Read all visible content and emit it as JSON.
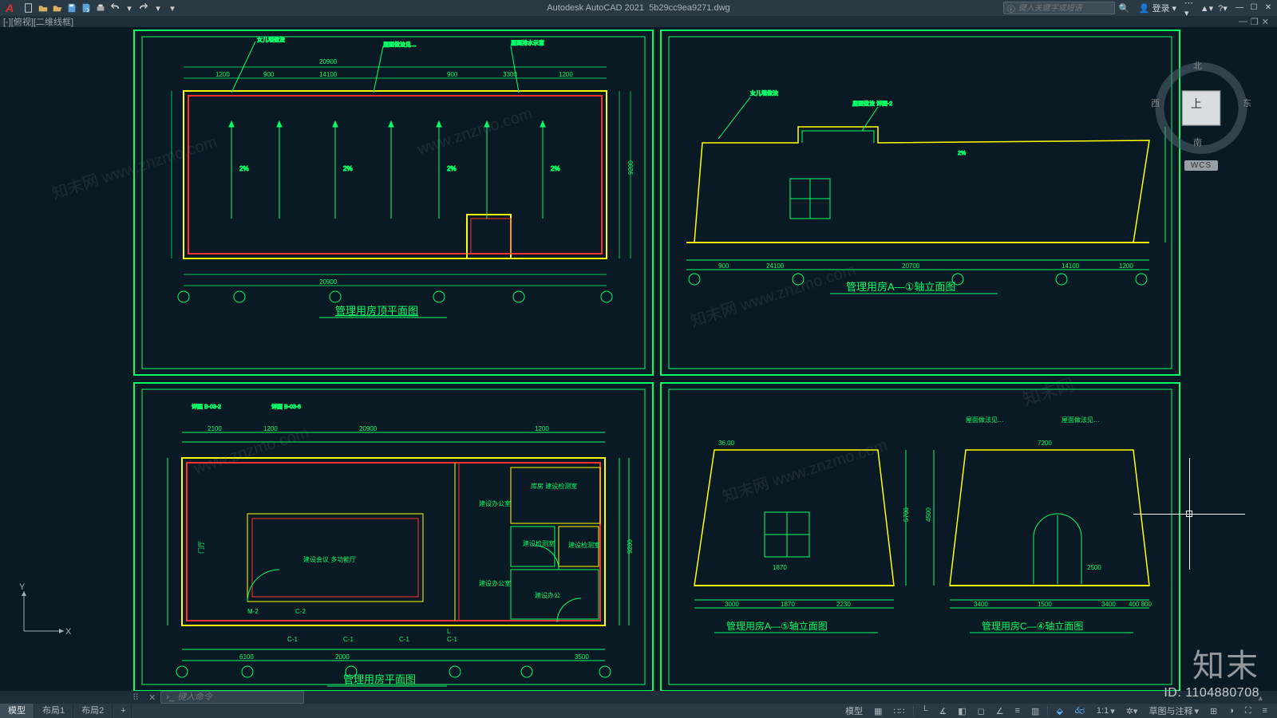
{
  "app": {
    "product": "Autodesk AutoCAD 2021",
    "filename": "5b29cc9ea9271.dwg"
  },
  "title": {
    "search_placeholder": "键入关键字或短语",
    "login": "登录"
  },
  "viewport": {
    "label": "[-][俯视][二维线框]"
  },
  "viewcube": {
    "n": "北",
    "s": "南",
    "e": "东",
    "w": "西",
    "top": "上",
    "wcs": "WCS"
  },
  "cmd": {
    "placeholder": "键入命令"
  },
  "layout_tabs": [
    "模型",
    "布局1",
    "布局2"
  ],
  "status": {
    "model_label": "模型",
    "scale": "1:1",
    "annotation_scale_label": "草图与注释"
  },
  "drawings": {
    "tl_title": "管理用房顶平面图",
    "tr_title": "管理用房A—①轴立面图",
    "bl_title": "管理用房平面图",
    "br1_title": "管理用房A—⑤轴立面图",
    "br2_title": "管理用房C—④轴立面图"
  },
  "watermark": {
    "logo": "知末",
    "id": "ID: 1104880708",
    "url": "www.znzmo.com",
    "cn": "知末网"
  }
}
